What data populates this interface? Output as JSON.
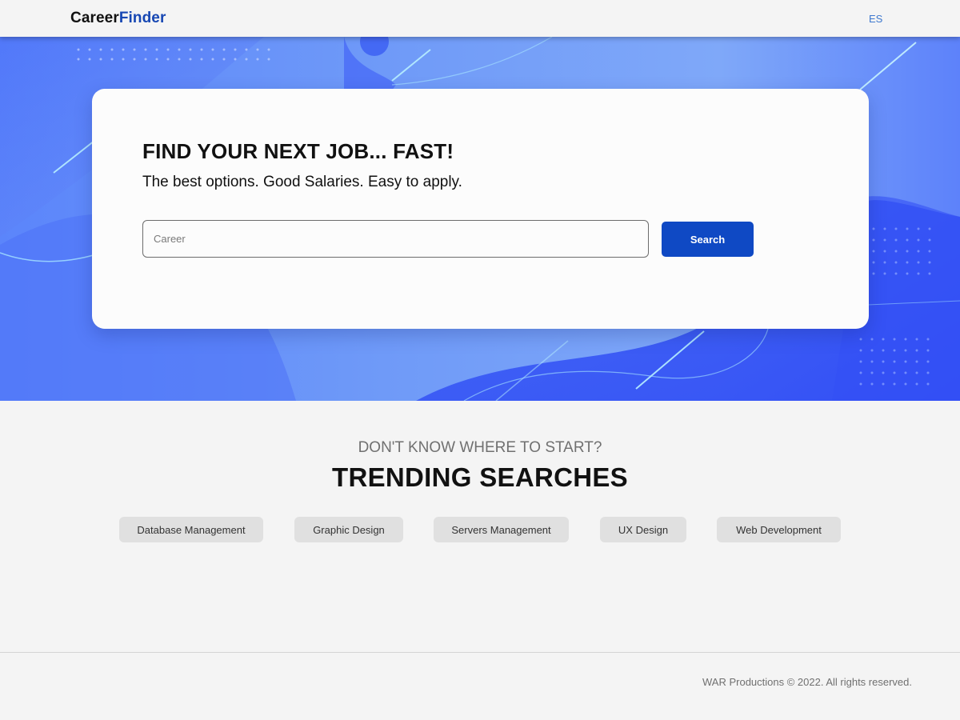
{
  "brand": {
    "name_part1": "Career",
    "name_part2": "Finder",
    "color_dark": "#111111",
    "color_accent": "#1747b3"
  },
  "header": {
    "language_link": "ES"
  },
  "hero": {
    "title": "FIND YOUR NEXT JOB... FAST!",
    "subtitle": "The best options. Good Salaries. Easy to apply.",
    "search": {
      "placeholder": "Career",
      "value": "",
      "button_label": "Search",
      "button_color": "#0f49c4"
    }
  },
  "trending": {
    "eyebrow": "DON'T KNOW WHERE TO START?",
    "title": "TRENDING SEARCHES",
    "tags": [
      "Database Management",
      "Graphic Design",
      "Servers Management",
      "UX Design",
      "Web Development"
    ]
  },
  "footer": {
    "copyright": "WAR Productions © 2022. All rights reserved."
  }
}
